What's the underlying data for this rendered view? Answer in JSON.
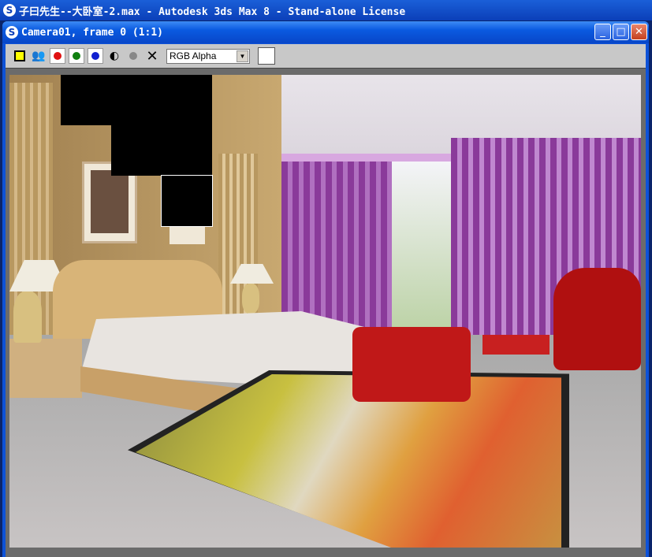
{
  "app": {
    "title": "子曰先生--大卧室-2.max - Autodesk 3ds Max 8  - Stand-alone License",
    "icon": "3dsmax-logo-icon"
  },
  "window": {
    "title": "Camera01, frame 0 (1:1)",
    "buttons": {
      "minimize": "_",
      "maximize": "□",
      "close": "✕"
    }
  },
  "toolbar": {
    "channel_select": "RGB Alpha",
    "colors": {
      "red": "#e01010",
      "green": "#108010",
      "blue": "#1020d0"
    }
  }
}
